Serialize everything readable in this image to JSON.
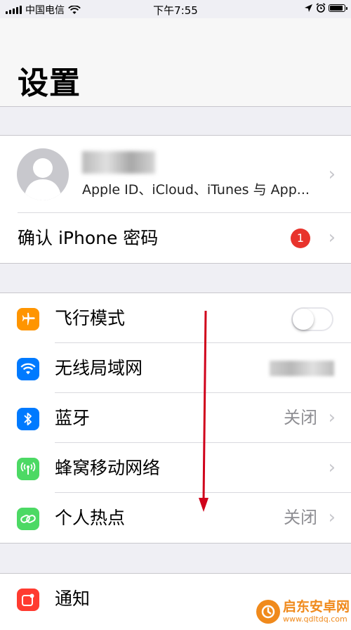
{
  "status_bar": {
    "carrier": "中国电信",
    "time": "下午7:55",
    "battery_level": 0.9
  },
  "header": {
    "title": "设置"
  },
  "profile": {
    "subtitle": "Apple ID、iCloud、iTunes 与 App...",
    "confirm_label": "确认 iPhone 密码",
    "badge_count": "1"
  },
  "network": {
    "items": [
      {
        "label": "飞行模式",
        "icon": "airplane-icon",
        "color": "#ff9500",
        "toggle_on": false
      },
      {
        "label": "无线局域网",
        "icon": "wifi-icon",
        "color": "#007aff"
      },
      {
        "label": "蓝牙",
        "icon": "bluetooth-icon",
        "color": "#007aff",
        "value": "关闭"
      },
      {
        "label": "蜂窝移动网络",
        "icon": "cellular-icon",
        "color": "#4cd964"
      },
      {
        "label": "个人热点",
        "icon": "hotspot-icon",
        "color": "#4cd964",
        "value": "关闭"
      }
    ]
  },
  "notifications": {
    "items": [
      {
        "label": "通知",
        "icon": "notifications-icon",
        "color": "#ff3b30"
      }
    ]
  },
  "chevron": "›",
  "annotation_arrow_color": "#d0021b",
  "watermark": {
    "title": "启东安卓网",
    "url": "www.qdltdq.com"
  }
}
